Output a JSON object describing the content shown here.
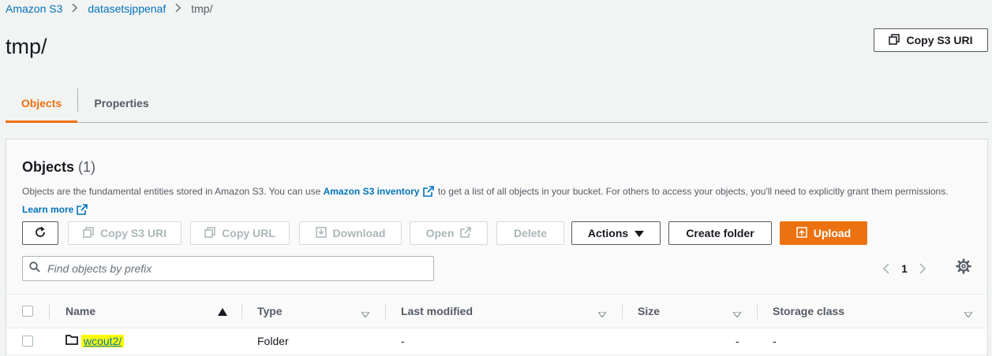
{
  "breadcrumb": {
    "items": [
      "Amazon S3",
      "datasetsjppenaf"
    ],
    "current": "tmp/"
  },
  "page": {
    "title": "tmp/",
    "copy_uri_label": "Copy S3 URI"
  },
  "tabs": [
    {
      "label": "Objects",
      "active": true
    },
    {
      "label": "Properties",
      "active": false
    }
  ],
  "objects_panel": {
    "title": "Objects",
    "count": "(1)",
    "desc_part1": "Objects are the fundamental entities stored in Amazon S3. You can use ",
    "inventory_link": "Amazon S3 inventory",
    "desc_part2": " to get a list of all objects in your bucket. For others to access your objects, you'll need to explicitly grant them permissions. ",
    "learn_more": "Learn more"
  },
  "toolbar": {
    "refresh_icon": "refresh-icon",
    "copy_s3_uri": "Copy S3 URI",
    "copy_url": "Copy URL",
    "download": "Download",
    "open": "Open",
    "delete": "Delete",
    "actions": "Actions",
    "create_folder": "Create folder",
    "upload": "Upload"
  },
  "search": {
    "placeholder": "Find objects by prefix"
  },
  "pagination": {
    "page": "1"
  },
  "table": {
    "columns": [
      "Name",
      "Type",
      "Last modified",
      "Size",
      "Storage class"
    ],
    "rows": [
      {
        "name": "wcout2/",
        "type": "Folder",
        "last_modified": "-",
        "size": "-",
        "storage_class": "-"
      }
    ]
  },
  "colors": {
    "accent": "#ec7211",
    "link": "#0073bb",
    "highlight": "#ffff00"
  }
}
